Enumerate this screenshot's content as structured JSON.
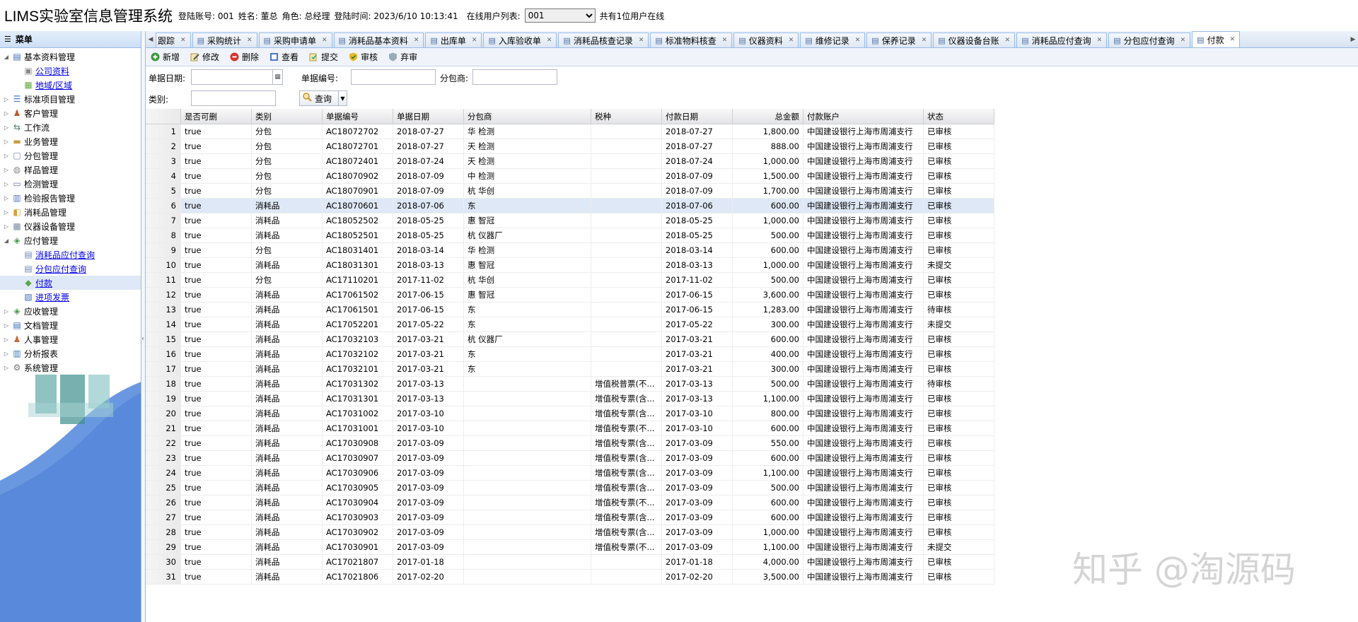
{
  "header": {
    "app_title": "LIMS实验室信息管理系统",
    "login_account": "登陆账号: 001",
    "name": "姓名: 董总",
    "role": "角色: 总经理",
    "login_time": "登陆时间: 2023/6/10 10:13:41",
    "online_label": "在线用户列表:",
    "online_user": "001",
    "online_count": "共有1位用户在线"
  },
  "sidebar": {
    "title": "菜单",
    "items": [
      {
        "label": "基本资料管理",
        "icon": "folder-icon",
        "expanded": true,
        "level": 0
      },
      {
        "label": "公司资料",
        "icon": "doc-icon",
        "level": 1
      },
      {
        "label": "地域/区域",
        "icon": "map-icon",
        "level": 1
      },
      {
        "label": "标准项目管理",
        "icon": "list-icon",
        "level": 0
      },
      {
        "label": "客户管理",
        "icon": "user-icon",
        "level": 0
      },
      {
        "label": "工作流",
        "icon": "flow-icon",
        "level": 0
      },
      {
        "label": "业务管理",
        "icon": "briefcase-icon",
        "level": 0
      },
      {
        "label": "分包管理",
        "icon": "package-icon",
        "level": 0
      },
      {
        "label": "样品管理",
        "icon": "sample-icon",
        "level": 0
      },
      {
        "label": "检测管理",
        "icon": "test-icon",
        "level": 0
      },
      {
        "label": "检验报告管理",
        "icon": "report-icon",
        "level": 0
      },
      {
        "label": "消耗品管理",
        "icon": "box-icon",
        "level": 0
      },
      {
        "label": "仪器设备管理",
        "icon": "device-icon",
        "level": 0
      },
      {
        "label": "应付管理",
        "icon": "payable-icon",
        "expanded": true,
        "level": 0
      },
      {
        "label": "消耗品应付查询",
        "icon": "query-icon",
        "level": 1
      },
      {
        "label": "分包应付查询",
        "icon": "query-icon",
        "level": 1
      },
      {
        "label": "付款",
        "icon": "pay-icon",
        "level": 1,
        "selected": true
      },
      {
        "label": "进项发票",
        "icon": "invoice-icon",
        "level": 1
      },
      {
        "label": "应收管理",
        "icon": "receivable-icon",
        "level": 0
      },
      {
        "label": "文档管理",
        "icon": "document-icon",
        "level": 0
      },
      {
        "label": "人事管理",
        "icon": "people-icon",
        "level": 0
      },
      {
        "label": "分析报表",
        "icon": "chart-icon",
        "level": 0
      },
      {
        "label": "系统管理",
        "icon": "gear-icon",
        "level": 0
      }
    ]
  },
  "tabs": [
    {
      "label": "跟踪"
    },
    {
      "label": "采购统计"
    },
    {
      "label": "采购申请单"
    },
    {
      "label": "消耗品基本资料"
    },
    {
      "label": "出库单"
    },
    {
      "label": "入库验收单"
    },
    {
      "label": "消耗品核查记录"
    },
    {
      "label": "标准物料核查"
    },
    {
      "label": "仪器资料"
    },
    {
      "label": "维修记录"
    },
    {
      "label": "保养记录"
    },
    {
      "label": "仪器设备台账"
    },
    {
      "label": "消耗品应付查询"
    },
    {
      "label": "分包应付查询"
    },
    {
      "label": "付款",
      "active": true
    }
  ],
  "toolbar": {
    "add": "新增",
    "edit": "修改",
    "delete": "删除",
    "view": "查看",
    "submit": "提交",
    "audit": "审核",
    "abandon": "弃审"
  },
  "filters": {
    "date_label": "单据日期:",
    "number_label": "单据编号:",
    "subcontractor_label": "分包商:",
    "category_label": "类别:",
    "query_button": "查询"
  },
  "grid": {
    "columns": [
      "是否可删",
      "类别",
      "单据编号",
      "单据日期",
      "分包商",
      "税种",
      "付款日期",
      "总金额",
      "付款账户",
      "状态"
    ],
    "rows": [
      [
        "1",
        "true",
        "分包",
        "AC18072702",
        "2018-07-27",
        "华 检测",
        "",
        "2018-07-27",
        "1,800.00",
        "中国建设银行上海市周浦支行",
        "已审核"
      ],
      [
        "2",
        "true",
        "分包",
        "AC18072701",
        "2018-07-27",
        "天 检测",
        "",
        "2018-07-27",
        "888.00",
        "中国建设银行上海市周浦支行",
        "已审核"
      ],
      [
        "3",
        "true",
        "分包",
        "AC18072401",
        "2018-07-24",
        "天 检测",
        "",
        "2018-07-24",
        "1,000.00",
        "中国建设银行上海市周浦支行",
        "已审核"
      ],
      [
        "4",
        "true",
        "分包",
        "AC18070902",
        "2018-07-09",
        "中 检测",
        "",
        "2018-07-09",
        "1,500.00",
        "中国建设银行上海市周浦支行",
        "已审核"
      ],
      [
        "5",
        "true",
        "分包",
        "AC18070901",
        "2018-07-09",
        "杭 华创",
        "",
        "2018-07-09",
        "1,700.00",
        "中国建设银行上海市周浦支行",
        "已审核"
      ],
      [
        "6",
        "true",
        "消耗品",
        "AC18070601",
        "2018-07-06",
        "东",
        "",
        "2018-07-06",
        "600.00",
        "中国建设银行上海市周浦支行",
        "已审核"
      ],
      [
        "7",
        "true",
        "消耗品",
        "AC18052502",
        "2018-05-25",
        "惠 智冠",
        "",
        "2018-05-25",
        "1,000.00",
        "中国建设银行上海市周浦支行",
        "已审核"
      ],
      [
        "8",
        "true",
        "消耗品",
        "AC18052501",
        "2018-05-25",
        "杭 仪器厂",
        "",
        "2018-05-25",
        "500.00",
        "中国建设银行上海市周浦支行",
        "已审核"
      ],
      [
        "9",
        "true",
        "分包",
        "AC18031401",
        "2018-03-14",
        "华 检测",
        "",
        "2018-03-14",
        "600.00",
        "中国建设银行上海市周浦支行",
        "已审核"
      ],
      [
        "10",
        "true",
        "消耗品",
        "AC18031301",
        "2018-03-13",
        "惠 智冠",
        "",
        "2018-03-13",
        "1,000.00",
        "中国建设银行上海市周浦支行",
        "未提交"
      ],
      [
        "11",
        "true",
        "分包",
        "AC17110201",
        "2017-11-02",
        "杭 华创",
        "",
        "2017-11-02",
        "500.00",
        "中国建设银行上海市周浦支行",
        "已审核"
      ],
      [
        "12",
        "true",
        "消耗品",
        "AC17061502",
        "2017-06-15",
        "惠 智冠",
        "",
        "2017-06-15",
        "3,600.00",
        "中国建设银行上海市周浦支行",
        "已审核"
      ],
      [
        "13",
        "true",
        "消耗品",
        "AC17061501",
        "2017-06-15",
        "东",
        "",
        "2017-06-15",
        "1,283.00",
        "中国建设银行上海市周浦支行",
        "待审核"
      ],
      [
        "14",
        "true",
        "消耗品",
        "AC17052201",
        "2017-05-22",
        "东",
        "",
        "2017-05-22",
        "300.00",
        "中国建设银行上海市周浦支行",
        "未提交"
      ],
      [
        "15",
        "true",
        "消耗品",
        "AC17032103",
        "2017-03-21",
        "杭 仪器厂",
        "",
        "2017-03-21",
        "600.00",
        "中国建设银行上海市周浦支行",
        "已审核"
      ],
      [
        "16",
        "true",
        "消耗品",
        "AC17032102",
        "2017-03-21",
        "东",
        "",
        "2017-03-21",
        "400.00",
        "中国建设银行上海市周浦支行",
        "已审核"
      ],
      [
        "17",
        "true",
        "消耗品",
        "AC17032101",
        "2017-03-21",
        "东",
        "",
        "2017-03-21",
        "300.00",
        "中国建设银行上海市周浦支行",
        "已审核"
      ],
      [
        "18",
        "true",
        "消耗品",
        "AC17031302",
        "2017-03-13",
        "",
        "增值税普票(不...",
        "2017-03-13",
        "500.00",
        "中国建设银行上海市周浦支行",
        "待审核"
      ],
      [
        "19",
        "true",
        "消耗品",
        "AC17031301",
        "2017-03-13",
        "",
        "增值税专票(含...",
        "2017-03-13",
        "1,100.00",
        "中国建设银行上海市周浦支行",
        "已审核"
      ],
      [
        "20",
        "true",
        "消耗品",
        "AC17031002",
        "2017-03-10",
        "",
        "增值税专票(含...",
        "2017-03-10",
        "800.00",
        "中国建设银行上海市周浦支行",
        "已审核"
      ],
      [
        "21",
        "true",
        "消耗品",
        "AC17031001",
        "2017-03-10",
        "",
        "增值税专票(不...",
        "2017-03-10",
        "600.00",
        "中国建设银行上海市周浦支行",
        "已审核"
      ],
      [
        "22",
        "true",
        "消耗品",
        "AC17030908",
        "2017-03-09",
        "",
        "增值税专票(含...",
        "2017-03-09",
        "550.00",
        "中国建设银行上海市周浦支行",
        "已审核"
      ],
      [
        "23",
        "true",
        "消耗品",
        "AC17030907",
        "2017-03-09",
        "",
        "增值税专票(含...",
        "2017-03-09",
        "600.00",
        "中国建设银行上海市周浦支行",
        "已审核"
      ],
      [
        "24",
        "true",
        "消耗品",
        "AC17030906",
        "2017-03-09",
        "",
        "增值税专票(含...",
        "2017-03-09",
        "1,100.00",
        "中国建设银行上海市周浦支行",
        "已审核"
      ],
      [
        "25",
        "true",
        "消耗品",
        "AC17030905",
        "2017-03-09",
        "",
        "增值税专票(含...",
        "2017-03-09",
        "500.00",
        "中国建设银行上海市周浦支行",
        "已审核"
      ],
      [
        "26",
        "true",
        "消耗品",
        "AC17030904",
        "2017-03-09",
        "",
        "增值税专票(不...",
        "2017-03-09",
        "600.00",
        "中国建设银行上海市周浦支行",
        "已审核"
      ],
      [
        "27",
        "true",
        "消耗品",
        "AC17030903",
        "2017-03-09",
        "",
        "增值税专票(含...",
        "2017-03-09",
        "600.00",
        "中国建设银行上海市周浦支行",
        "已审核"
      ],
      [
        "28",
        "true",
        "消耗品",
        "AC17030902",
        "2017-03-09",
        "",
        "增值税专票(含...",
        "2017-03-09",
        "1,000.00",
        "中国建设银行上海市周浦支行",
        "已审核"
      ],
      [
        "29",
        "true",
        "消耗品",
        "AC17030901",
        "2017-03-09",
        "",
        "增值税专票(不...",
        "2017-03-09",
        "1,100.00",
        "中国建设银行上海市周浦支行",
        "未提交"
      ],
      [
        "30",
        "true",
        "消耗品",
        "AC17021807",
        "2017-01-18",
        "",
        "",
        "2017-01-18",
        "4,000.00",
        "中国建设银行上海市周浦支行",
        "已审核"
      ],
      [
        "31",
        "true",
        "消耗品",
        "AC17021806",
        "2017-02-20",
        "",
        "",
        "2017-02-20",
        "3,500.00",
        "中国建设银行上海市周浦支行",
        "已审核"
      ]
    ],
    "selected_row": 6
  },
  "watermark": "知乎 @淘源码",
  "colors": {
    "accent": "#99bbe8",
    "selection": "#dfe8f6",
    "header_bg": "#d7e3f2"
  }
}
